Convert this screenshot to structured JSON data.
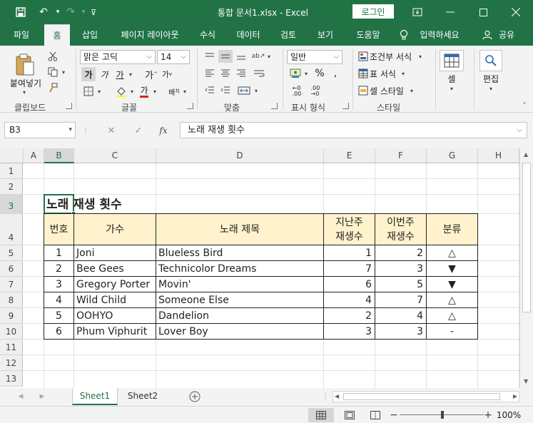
{
  "titlebar": {
    "title": "통합 문서1.xlsx  -  Excel",
    "login": "로그인"
  },
  "tabs": [
    "파일",
    "홈",
    "삽입",
    "페이지 레이아웃",
    "수식",
    "데이터",
    "검토",
    "보기",
    "도움말"
  ],
  "tell_me": "입력하세요",
  "share": "공유",
  "ribbon": {
    "paste_label": "붙여넣기",
    "font_name": "맑은 고딕",
    "font_size": "14",
    "number_format": "일반",
    "cond_format": "조건부 서식",
    "table_format": "표 서식",
    "cell_style": "셀 스타일",
    "cells_label": "셀",
    "edit_label": "편집",
    "groups": {
      "clipboard": "클립보드",
      "font": "글꼴",
      "align": "맞춤",
      "number": "표시 형식",
      "style": "스타일"
    }
  },
  "formula": {
    "namebox": "B3",
    "content": "노래 재생 횟수"
  },
  "grid": {
    "columns": [
      "A",
      "B",
      "C",
      "D",
      "E",
      "F",
      "G",
      "H"
    ],
    "rows": [
      "1",
      "2",
      "3",
      "4",
      "5",
      "6",
      "7",
      "8",
      "9",
      "10",
      "11",
      "12",
      "13"
    ],
    "title": "노래 재생 횟수",
    "headers": {
      "no": "번호",
      "artist": "가수",
      "song": "노래 제목",
      "last": "지난주\n재생수",
      "this": "이번주\n재생수",
      "cat": "분류"
    },
    "data": [
      {
        "no": "1",
        "artist": "Joni",
        "song": "Blueless Bird",
        "last": "1",
        "this": "2",
        "cat": "△"
      },
      {
        "no": "2",
        "artist": "Bee Gees",
        "song": "Technicolor Dreams",
        "last": "7",
        "this": "3",
        "cat": "▼"
      },
      {
        "no": "3",
        "artist": "Gregory Porter",
        "song": "Movin'",
        "last": "6",
        "this": "5",
        "cat": "▼"
      },
      {
        "no": "4",
        "artist": "Wild Child",
        "song": "Someone Else",
        "last": "4",
        "this": "7",
        "cat": "△"
      },
      {
        "no": "5",
        "artist": "OOHYO",
        "song": "Dandelion",
        "last": "2",
        "this": "4",
        "cat": "△"
      },
      {
        "no": "6",
        "artist": "Phum Viphurit",
        "song": "Lover Boy",
        "last": "3",
        "this": "3",
        "cat": "-"
      }
    ]
  },
  "sheets": [
    "Sheet1",
    "Sheet2"
  ],
  "status": {
    "zoom": "100%"
  },
  "colors": {
    "accent": "#217346",
    "header_fill": "#fff2cc"
  }
}
